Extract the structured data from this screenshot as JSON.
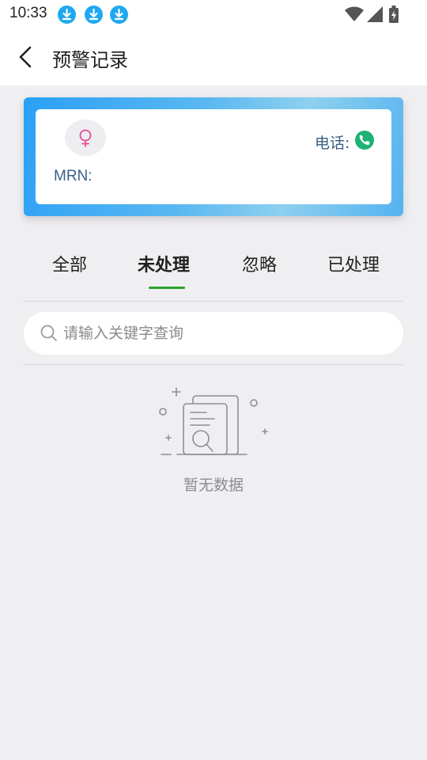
{
  "status_bar": {
    "time": "10:33",
    "download_icons": [
      "download-icon",
      "download-icon",
      "download-icon"
    ],
    "right_icons": [
      "wifi-icon",
      "cell-signal-icon",
      "battery-charging-icon"
    ]
  },
  "header": {
    "back_icon": "chevron-left-icon",
    "title": "预警记录"
  },
  "patient_card": {
    "gender_icon": "female-icon",
    "gender_color": "#e8489a",
    "phone_label": "电话:",
    "phone_icon": "phone-icon",
    "phone_icon_color": "#1eb273",
    "mrn_label": "MRN:"
  },
  "tabs": [
    {
      "label": "全部",
      "active": false
    },
    {
      "label": "未处理",
      "active": true
    },
    {
      "label": "忽略",
      "active": false
    },
    {
      "label": "已处理",
      "active": false
    }
  ],
  "search": {
    "icon": "search-icon",
    "placeholder": "请输入关键字查询",
    "value": ""
  },
  "empty_state": {
    "icon": "empty-document-search-icon",
    "text": "暂无数据"
  },
  "colors": {
    "accent_tab": "#2aa32a",
    "card_gradient_start": "#2aa0f6",
    "card_gradient_end": "#8dd0ef",
    "label_text": "#3a5f86"
  }
}
